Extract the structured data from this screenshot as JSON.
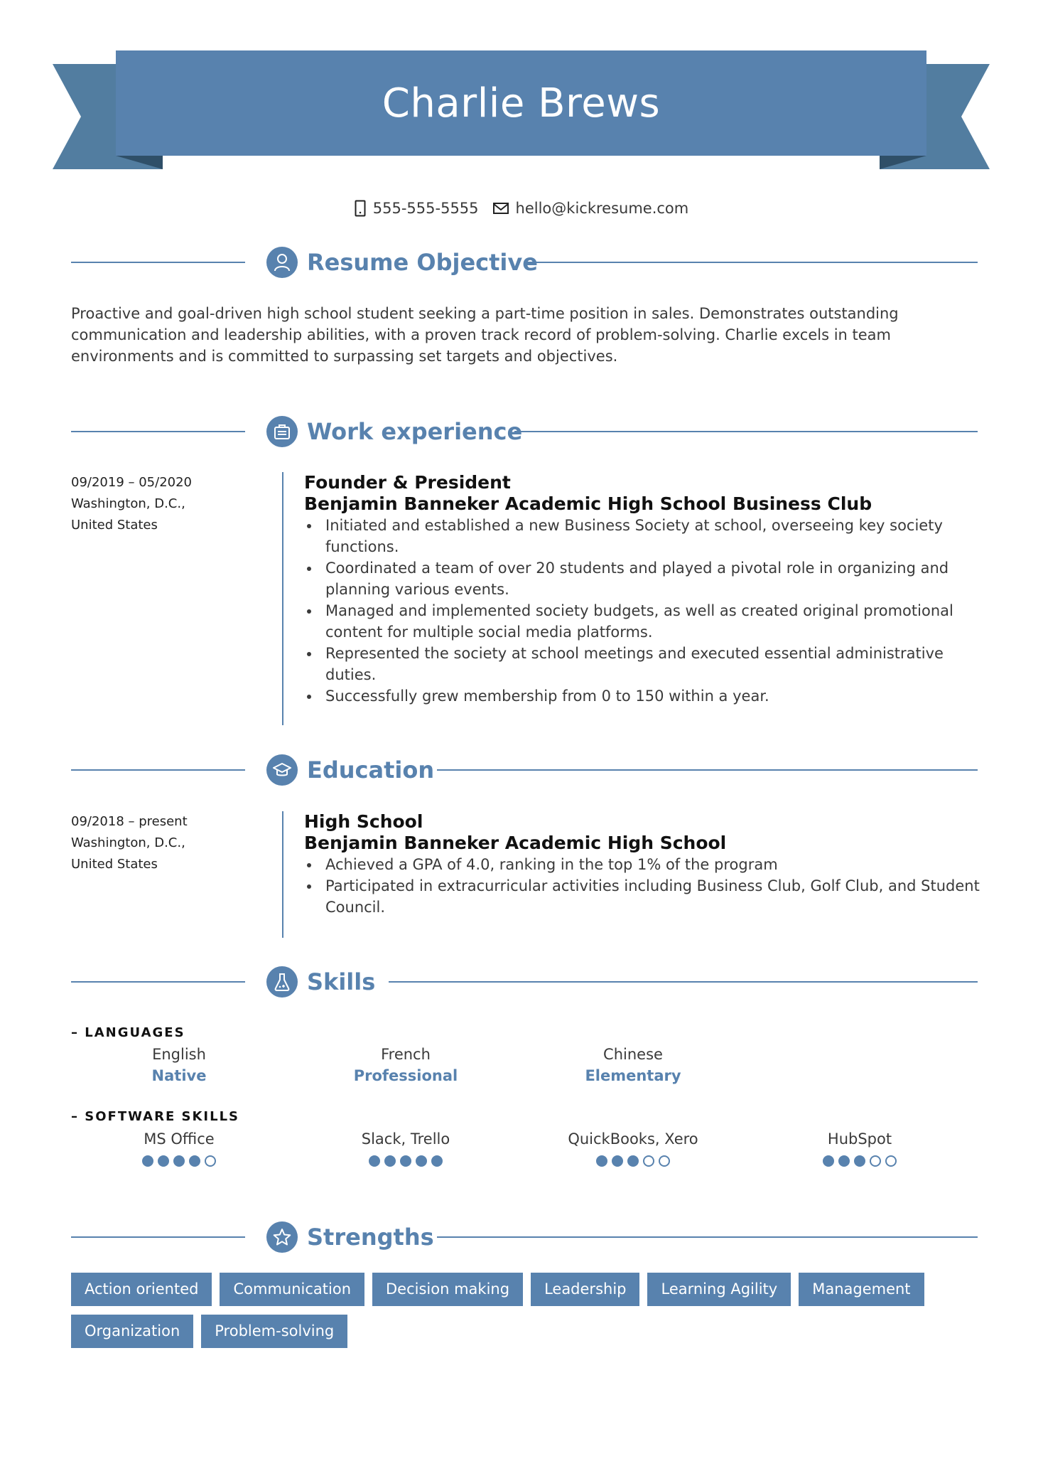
{
  "header": {
    "name": "Charlie Brews",
    "phone": "555-555-5555",
    "email": "hello@kickresume.com",
    "phone_icon": "phone-icon",
    "email_icon": "envelope-icon"
  },
  "colors": {
    "accent": "#5882ae",
    "ribbon_tail": "#527da0",
    "ribbon_fold": "#2f4f68",
    "text": "#3a3a3a"
  },
  "sections": {
    "objective": {
      "title": "Resume Objective",
      "icon": "user-icon",
      "text": "Proactive and goal-driven high school student seeking a part-time position in sales. Demonstrates outstanding communication and leadership abilities, with a proven track record of problem-solving. Charlie excels in team environments and is committed to surpassing set targets and objectives."
    },
    "work": {
      "title": "Work experience",
      "icon": "briefcase-icon",
      "entries": [
        {
          "dates": "09/2019 – 05/2020",
          "city": "Washington, D.C.,",
          "country": "United States",
          "role": "Founder & President",
          "org": "Benjamin Banneker Academic High School Business Club",
          "bullets": [
            "Initiated and established a new Business Society at school, overseeing key society functions.",
            "Coordinated a team of over 20 students and played a pivotal role in organizing and planning various events.",
            "Managed and implemented society budgets, as well as created original promotional content for multiple social media platforms.",
            "Represented the society at school meetings and executed essential administrative duties.",
            "Successfully grew membership from 0 to 150 within a year."
          ]
        }
      ]
    },
    "education": {
      "title": "Education",
      "icon": "graduation-cap-icon",
      "entries": [
        {
          "dates": "09/2018 – present",
          "city": "Washington, D.C.,",
          "country": "United States",
          "role": "High School",
          "org": "Benjamin Banneker Academic High School",
          "bullets": [
            "Achieved a GPA of 4.0, ranking in the top 1% of the program",
            "Participated in extracurricular activities including Business Club, Golf Club, and Student Council."
          ]
        }
      ]
    },
    "skills": {
      "title": "Skills",
      "icon": "flask-icon",
      "languages_label": "– LANGUAGES",
      "languages": [
        {
          "name": "English",
          "level": "Native"
        },
        {
          "name": "French",
          "level": "Professional"
        },
        {
          "name": "Chinese",
          "level": "Elementary"
        }
      ],
      "software_label": "– SOFTWARE SKILLS",
      "software": [
        {
          "name": "MS Office",
          "rating": 4,
          "max": 5
        },
        {
          "name": "Slack, Trello",
          "rating": 5,
          "max": 5
        },
        {
          "name": "QuickBooks, Xero",
          "rating": 3,
          "max": 5
        },
        {
          "name": "HubSpot",
          "rating": 3,
          "max": 5
        }
      ]
    },
    "strengths": {
      "title": "Strengths",
      "icon": "star-icon",
      "tags": [
        "Action oriented",
        "Communication",
        "Decision making",
        "Leadership",
        "Learning Agility",
        "Management",
        "Organization",
        "Problem-solving"
      ]
    }
  }
}
